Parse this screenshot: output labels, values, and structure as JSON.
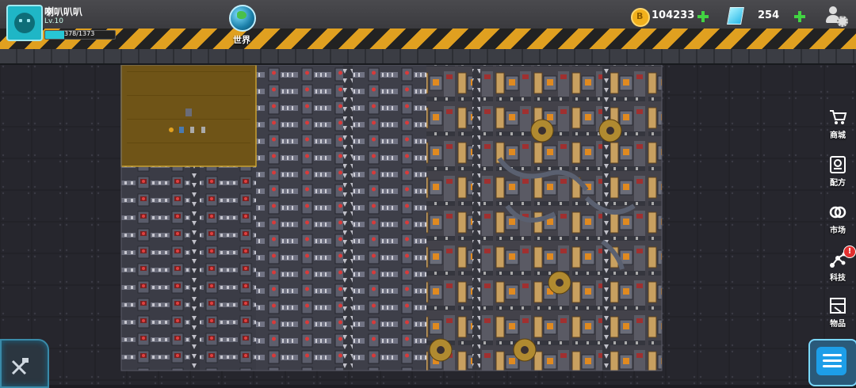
{
  "player": {
    "name": "喇叭叭叭",
    "level": "Lv.10",
    "xp_text": "378/1373",
    "xp_progress": 0.275
  },
  "world_button": {
    "label": "世界"
  },
  "currency": {
    "coins": {
      "value": "104233",
      "icon": "coin-icon",
      "symbol": "B"
    },
    "gems": {
      "value": "254",
      "icon": "gem-icon"
    }
  },
  "side_menu": [
    {
      "id": "shop",
      "label": "商城",
      "icon": "cart-icon"
    },
    {
      "id": "recipe",
      "label": "配方",
      "icon": "recipe-icon"
    },
    {
      "id": "market",
      "label": "市场",
      "icon": "market-icon"
    },
    {
      "id": "tech",
      "label": "科技",
      "icon": "tech-icon",
      "badge": "!"
    },
    {
      "id": "items",
      "label": "物品",
      "icon": "items-icon"
    }
  ],
  "colors": {
    "accent": "#27c6d6",
    "hazard_yellow": "#e0a020",
    "plus_green": "#42d442",
    "badge_red": "#e23030",
    "selected_zone": "#7a5a10"
  },
  "tools_button": {
    "icon": "wrench-hammer-icon"
  },
  "menu_button": {
    "icon": "list-icon"
  }
}
